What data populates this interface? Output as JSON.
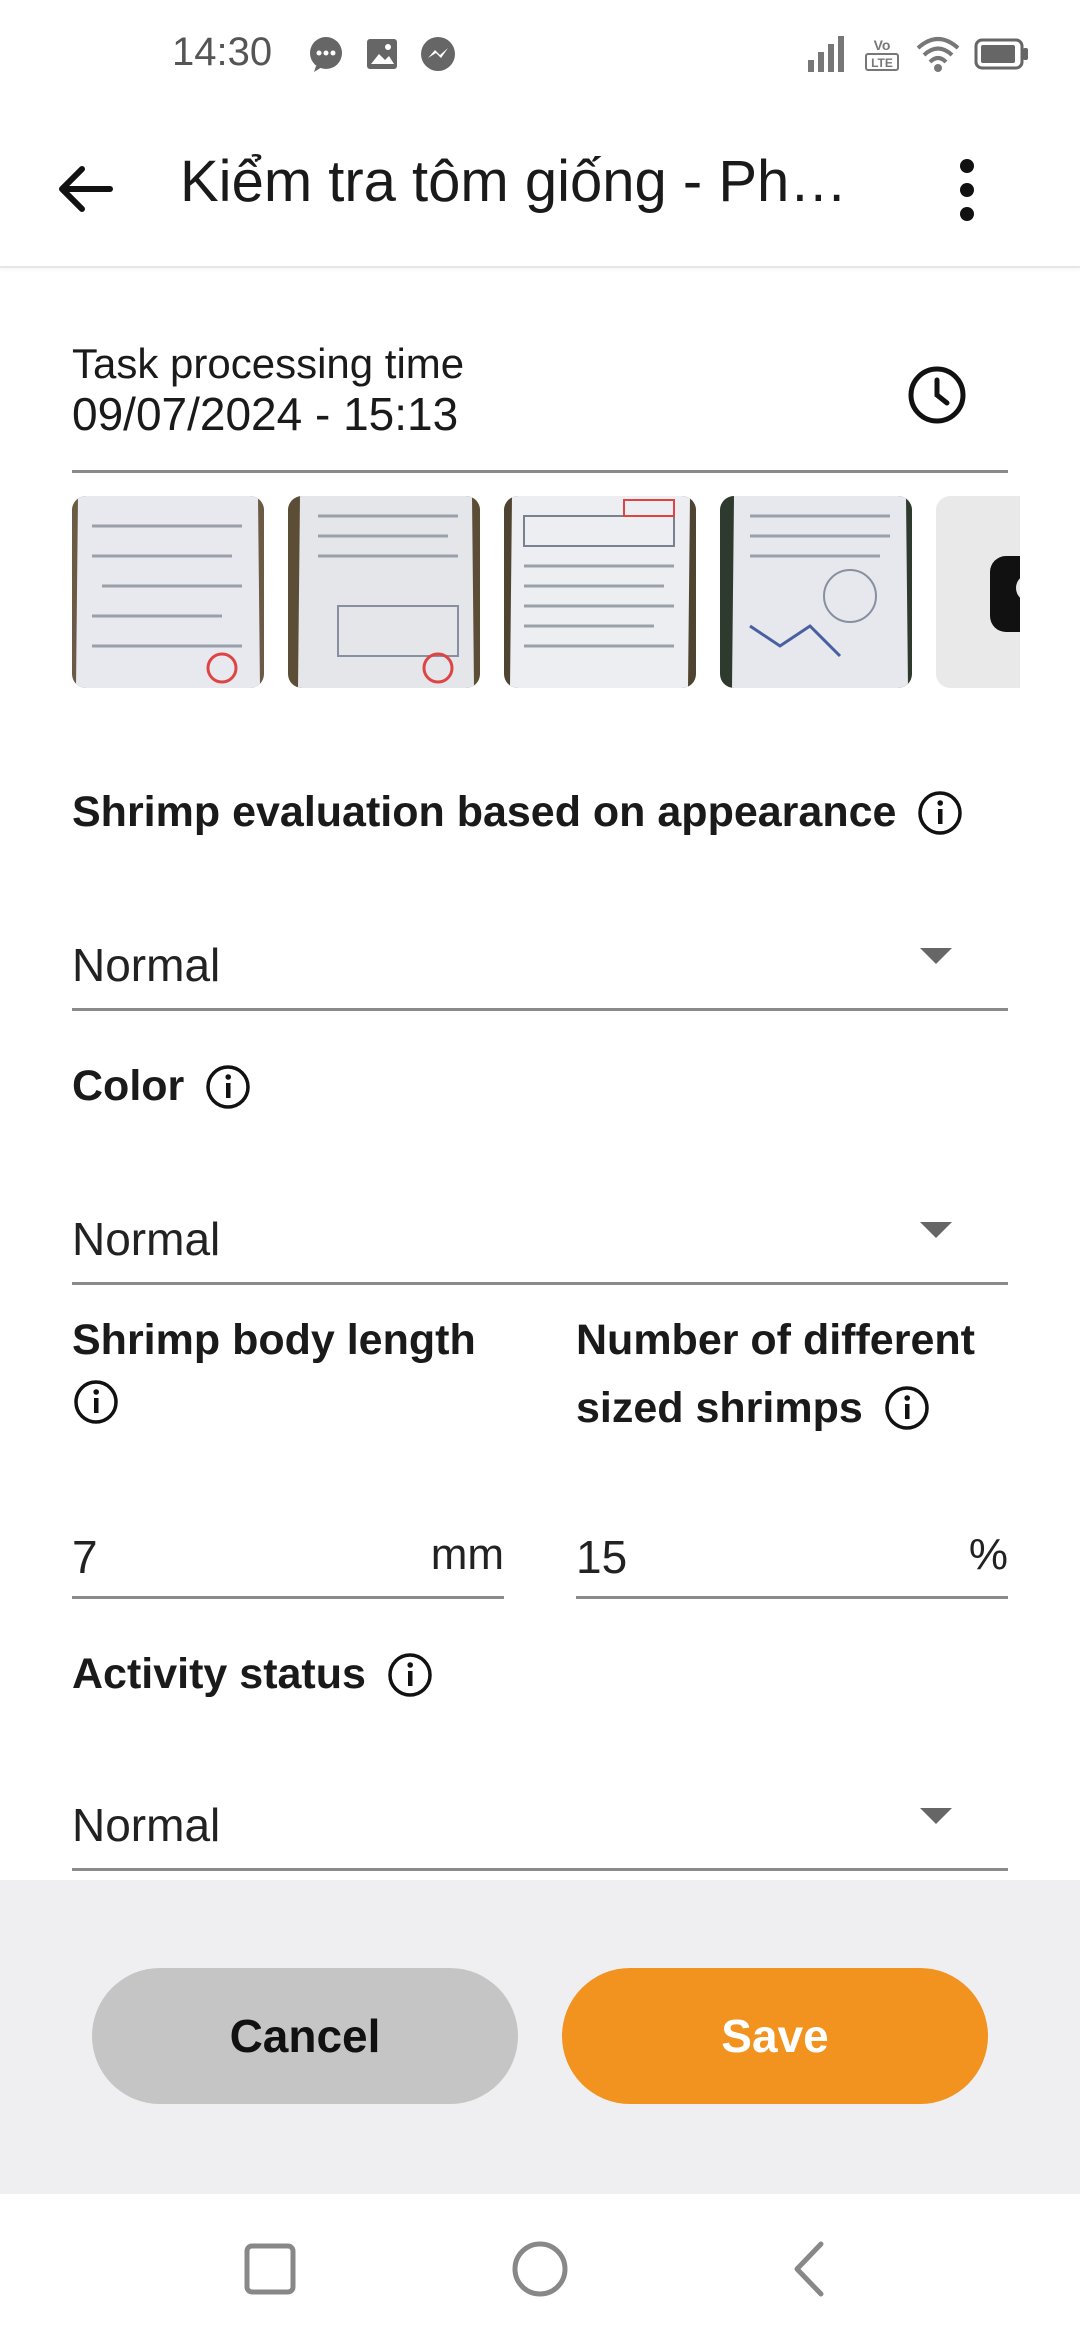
{
  "status_bar": {
    "time": "14:30",
    "icons_left": [
      "chat-bubble-icon",
      "image-icon",
      "messenger-icon"
    ],
    "icons_right": [
      "signal-icon",
      "volte-lte-icon",
      "wifi-icon",
      "battery-icon"
    ],
    "volte_label_top": "Vo",
    "volte_label_bottom": "LTE"
  },
  "app_bar": {
    "title": "Kiểm tra tôm giống  - Ph…"
  },
  "task_time": {
    "label": "Task processing time",
    "value": "09/07/2024 - 15:13"
  },
  "photos": {
    "count_visible": 4,
    "add_button_icon": "camera-icon"
  },
  "form": {
    "appearance": {
      "label": "Shrimp evaluation based on appearance",
      "value": "Normal"
    },
    "color": {
      "label": "Color",
      "value": "Normal"
    },
    "body_length": {
      "label_line1": "Shrimp body length",
      "value": "7",
      "unit": "mm"
    },
    "different_sizes": {
      "label_line1": "Number of different",
      "label_line2": "sized shrimps",
      "value": "15",
      "unit": "%"
    },
    "activity": {
      "label": "Activity status",
      "value": "Normal"
    }
  },
  "actions": {
    "cancel_label": "Cancel",
    "save_label": "Save"
  },
  "colors": {
    "accent": "#f2921f",
    "cancel_bg": "#c5c5c5",
    "action_bar_bg": "#efeff1"
  }
}
